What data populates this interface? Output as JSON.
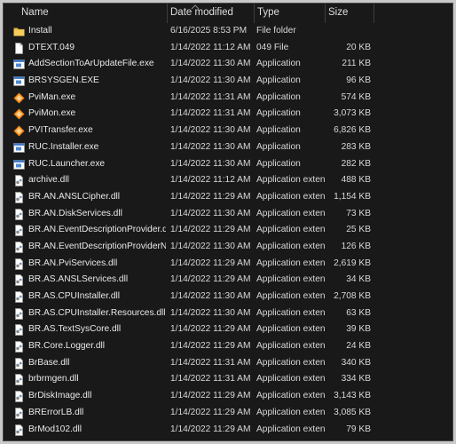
{
  "columns": {
    "name": "Name",
    "date": "Date modified",
    "type": "Type",
    "size": "Size"
  },
  "files": [
    {
      "name": "Install",
      "date": "6/16/2025 8:53 PM",
      "type": "File folder",
      "size": "",
      "icon": "folder-icon"
    },
    {
      "name": "DTEXT.049",
      "date": "1/14/2022 11:12 AM",
      "type": "049 File",
      "size": "20 KB",
      "icon": "file-icon"
    },
    {
      "name": "AddSectionToArUpdateFile.exe",
      "date": "1/14/2022 11:30 AM",
      "type": "Application",
      "size": "211 KB",
      "icon": "app-icon"
    },
    {
      "name": "BRSYSGEN.EXE",
      "date": "1/14/2022 11:30 AM",
      "type": "Application",
      "size": "96 KB",
      "icon": "app-icon"
    },
    {
      "name": "PviMan.exe",
      "date": "1/14/2022 11:31 AM",
      "type": "Application",
      "size": "574 KB",
      "icon": "pvi-icon"
    },
    {
      "name": "PviMon.exe",
      "date": "1/14/2022 11:31 AM",
      "type": "Application",
      "size": "3,073 KB",
      "icon": "pvi-icon"
    },
    {
      "name": "PVITransfer.exe",
      "date": "1/14/2022 11:30 AM",
      "type": "Application",
      "size": "6,826 KB",
      "icon": "pvi-icon"
    },
    {
      "name": "RUC.Installer.exe",
      "date": "1/14/2022 11:30 AM",
      "type": "Application",
      "size": "283 KB",
      "icon": "app-icon"
    },
    {
      "name": "RUC.Launcher.exe",
      "date": "1/14/2022 11:30 AM",
      "type": "Application",
      "size": "282 KB",
      "icon": "app-icon"
    },
    {
      "name": "archive.dll",
      "date": "1/14/2022 11:12 AM",
      "type": "Application extens...",
      "size": "488 KB",
      "icon": "dll-icon"
    },
    {
      "name": "BR.AN.ANSLCipher.dll",
      "date": "1/14/2022 11:29 AM",
      "type": "Application extens...",
      "size": "1,154 KB",
      "icon": "dll-icon"
    },
    {
      "name": "BR.AN.DiskServices.dll",
      "date": "1/14/2022 11:30 AM",
      "type": "Application extens...",
      "size": "73 KB",
      "icon": "dll-icon"
    },
    {
      "name": "BR.AN.EventDescriptionProvider.dll",
      "date": "1/14/2022 11:29 AM",
      "type": "Application extens...",
      "size": "25 KB",
      "icon": "dll-icon"
    },
    {
      "name": "BR.AN.EventDescriptionProviderNet.dll",
      "date": "1/14/2022 11:30 AM",
      "type": "Application extens...",
      "size": "126 KB",
      "icon": "dll-icon"
    },
    {
      "name": "BR.AN.PviServices.dll",
      "date": "1/14/2022 11:29 AM",
      "type": "Application extens...",
      "size": "2,619 KB",
      "icon": "dll-icon"
    },
    {
      "name": "BR.AS.ANSLServices.dll",
      "date": "1/14/2022 11:29 AM",
      "type": "Application extens...",
      "size": "34 KB",
      "icon": "dll-icon"
    },
    {
      "name": "BR.AS.CPUInstaller.dll",
      "date": "1/14/2022 11:30 AM",
      "type": "Application extens...",
      "size": "2,708 KB",
      "icon": "dll-icon"
    },
    {
      "name": "BR.AS.CPUInstaller.Resources.dll",
      "date": "1/14/2022 11:30 AM",
      "type": "Application extens...",
      "size": "63 KB",
      "icon": "dll-icon"
    },
    {
      "name": "BR.AS.TextSysCore.dll",
      "date": "1/14/2022 11:29 AM",
      "type": "Application extens...",
      "size": "39 KB",
      "icon": "dll-icon"
    },
    {
      "name": "BR.Core.Logger.dll",
      "date": "1/14/2022 11:29 AM",
      "type": "Application extens...",
      "size": "24 KB",
      "icon": "dll-icon"
    },
    {
      "name": "BrBase.dll",
      "date": "1/14/2022 11:31 AM",
      "type": "Application extens...",
      "size": "340 KB",
      "icon": "dll-icon"
    },
    {
      "name": "brbrmgen.dll",
      "date": "1/14/2022 11:31 AM",
      "type": "Application extens...",
      "size": "334 KB",
      "icon": "dll-icon"
    },
    {
      "name": "BrDiskImage.dll",
      "date": "1/14/2022 11:29 AM",
      "type": "Application extens...",
      "size": "3,143 KB",
      "icon": "dll-icon"
    },
    {
      "name": "BRErrorLB.dll",
      "date": "1/14/2022 11:29 AM",
      "type": "Application extens...",
      "size": "3,085 KB",
      "icon": "dll-icon"
    },
    {
      "name": "BrMod102.dll",
      "date": "1/14/2022 11:29 AM",
      "type": "Application extens...",
      "size": "79 KB",
      "icon": "dll-icon"
    }
  ]
}
